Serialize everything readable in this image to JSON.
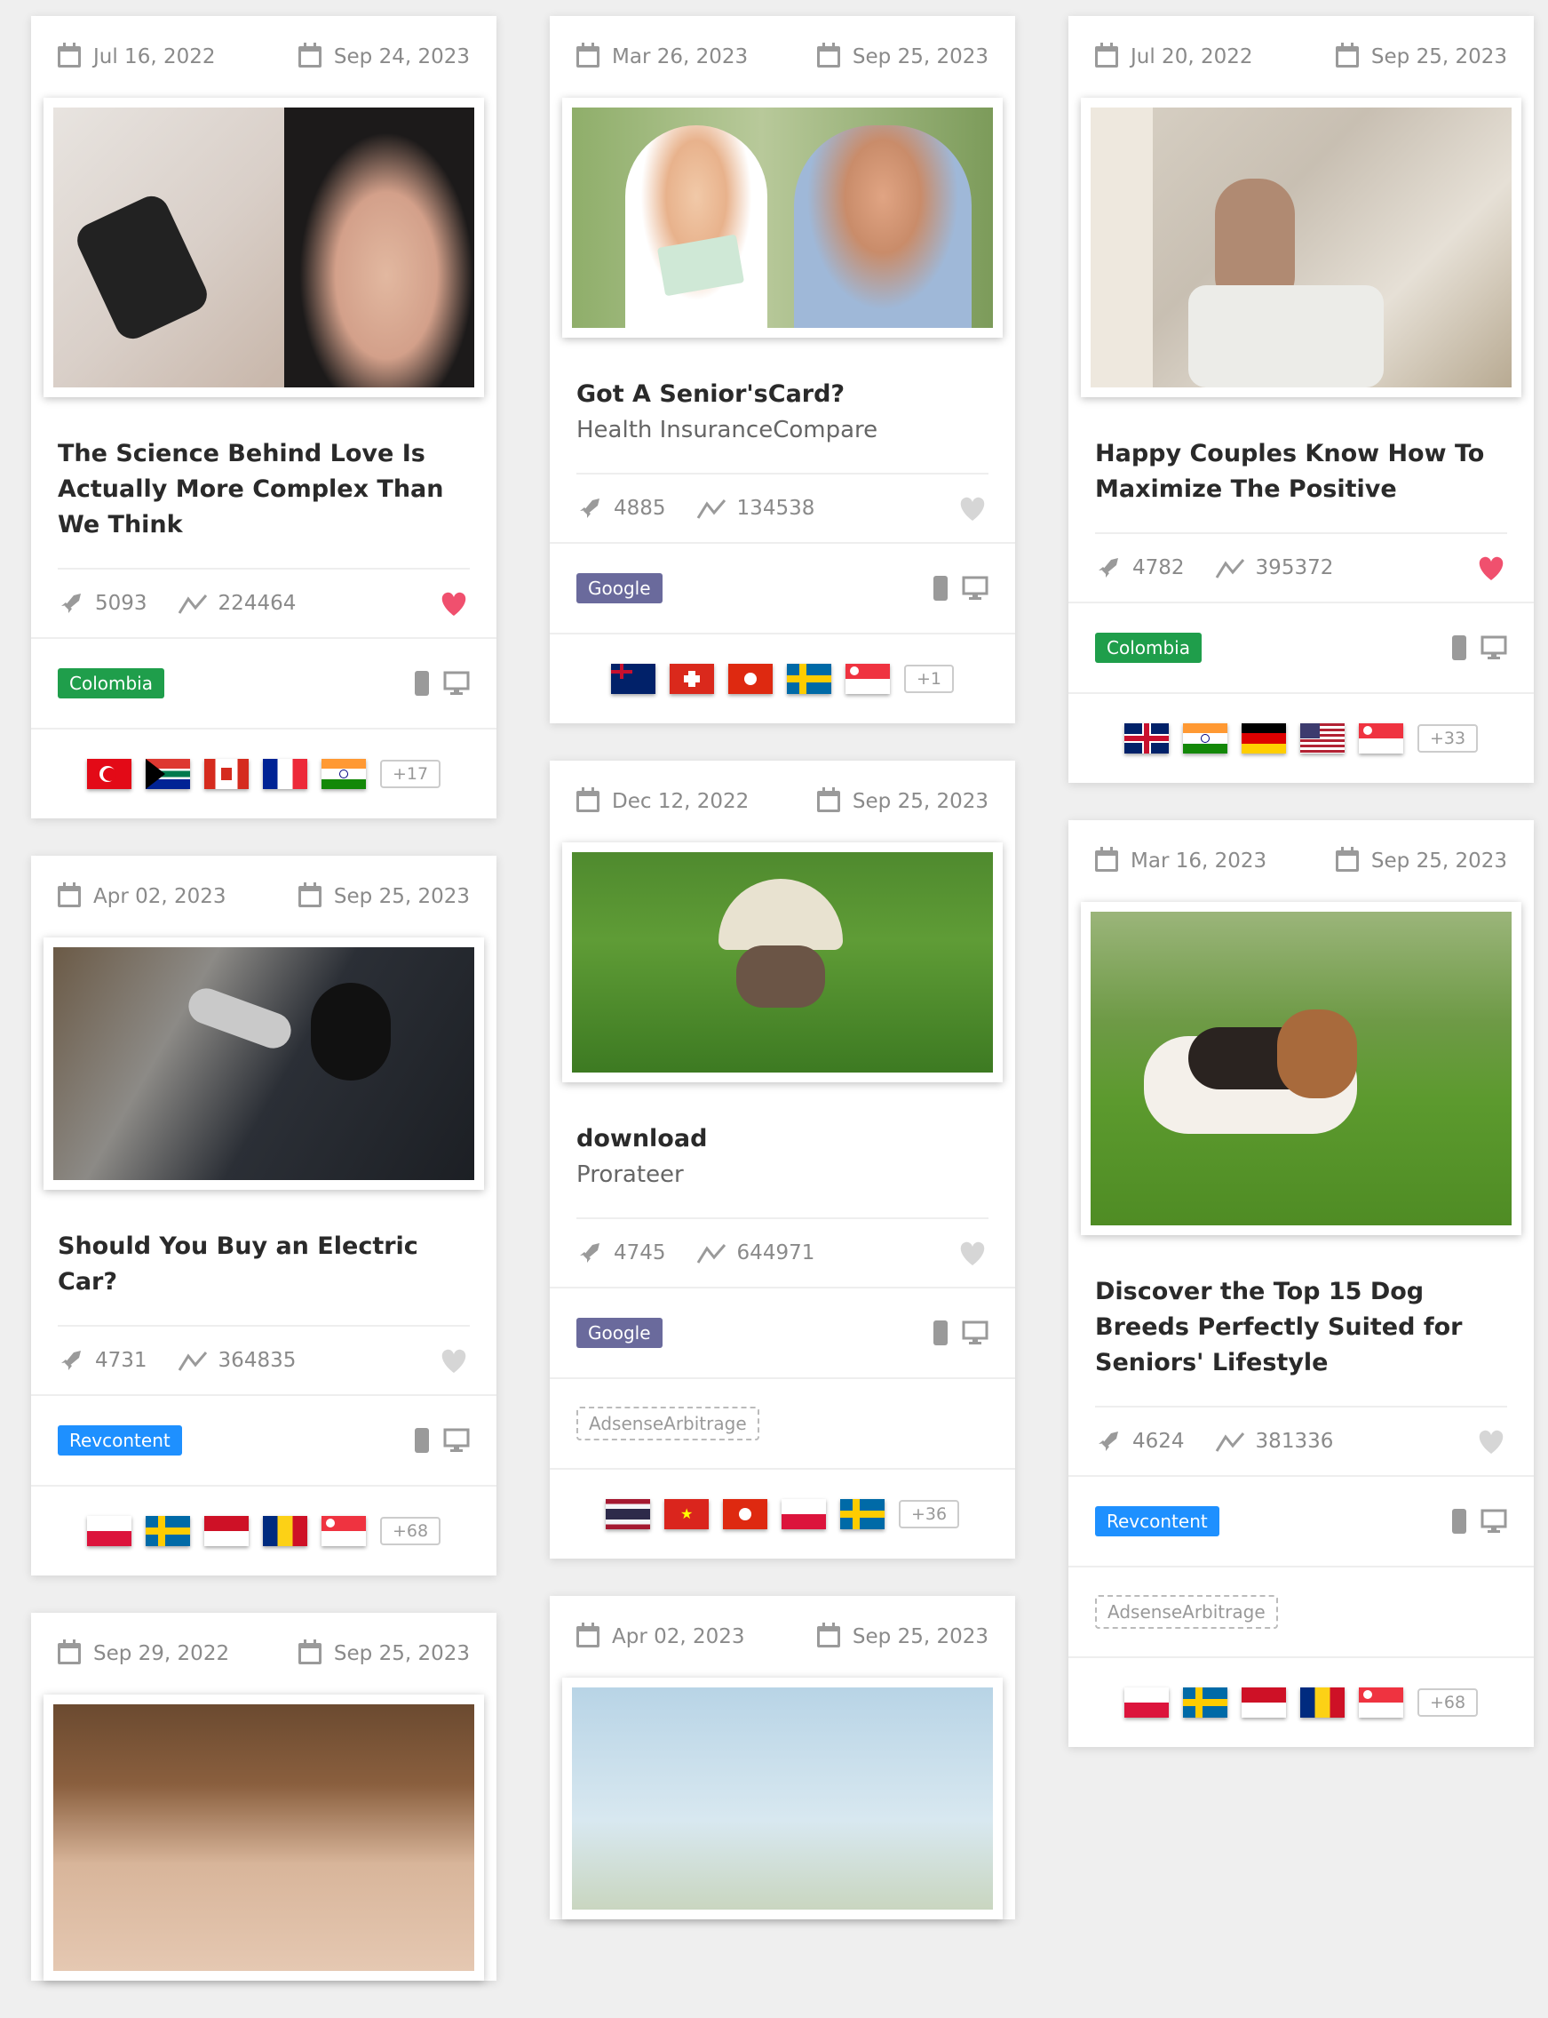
{
  "cards": {
    "c1": [
      {
        "date_start": "Jul 16, 2022",
        "date_end": "Sep 24, 2023",
        "title": "The Science Behind Love Is Actually More Complex Than We Think",
        "rocket": "5093",
        "trend": "224464",
        "liked": true,
        "network": "Colombia",
        "more": "+17"
      },
      {
        "date_start": "Apr 02, 2023",
        "date_end": "Sep 25, 2023",
        "title": "Should You Buy an Electric Car?",
        "rocket": "4731",
        "trend": "364835",
        "liked": false,
        "network": "Revcontent",
        "more": "+68"
      },
      {
        "date_start": "Sep 29, 2022",
        "date_end": "Sep 25, 2023"
      }
    ],
    "c2": [
      {
        "date_start": "Mar 26, 2023",
        "date_end": "Sep 25, 2023",
        "title": "Got A Senior'sCard?",
        "subtitle": "Health InsuranceCompare",
        "rocket": "4885",
        "trend": "134538",
        "liked": false,
        "network": "Google",
        "more": "+1"
      },
      {
        "date_start": "Dec 12, 2022",
        "date_end": "Sep 25, 2023",
        "title": "download",
        "subtitle": "Prorateer",
        "rocket": "4745",
        "trend": "644971",
        "liked": false,
        "network": "Google",
        "ad_tag": "AdsenseArbitrage",
        "more": "+36"
      },
      {
        "date_start": "Apr 02, 2023",
        "date_end": "Sep 25, 2023"
      }
    ],
    "c3": [
      {
        "date_start": "Jul 20, 2022",
        "date_end": "Sep 25, 2023",
        "title": "Happy Couples Know How To Maximize The Positive",
        "rocket": "4782",
        "trend": "395372",
        "liked": true,
        "network": "Colombia",
        "more": "+33"
      },
      {
        "date_start": "Mar 16, 2023",
        "date_end": "Sep 25, 2023",
        "title": "Discover the Top 15 Dog Breeds Perfectly Suited for Seniors' Lifestyle",
        "rocket": "4624",
        "trend": "381336",
        "liked": false,
        "network": "Revcontent",
        "ad_tag": "AdsenseArbitrage",
        "more": "+68"
      }
    ]
  },
  "colors": {
    "liked": "#f0506e",
    "unliked": "#d6d6d6",
    "colombia": "#1f9e4b",
    "google": "#6a6a9c",
    "revcontent": "#1e90ff"
  }
}
